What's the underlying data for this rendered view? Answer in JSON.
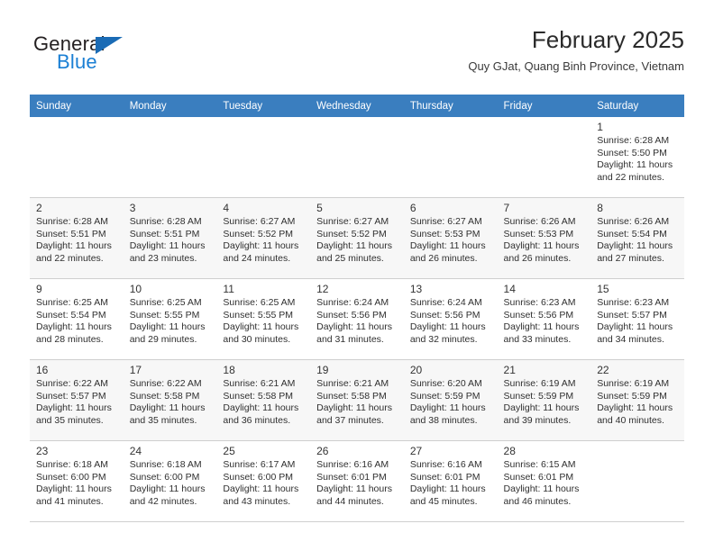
{
  "logo": {
    "text_top": "General",
    "text_bottom": "Blue",
    "triangle_icon": "blue-triangle-icon",
    "color_dark": "#231f20",
    "color_blue": "#1a7fd4"
  },
  "header": {
    "title": "February 2025",
    "subtitle": "Quy GJat, Quang Binh Province, Vietnam"
  },
  "theme": {
    "header_row_bg": "#3a7ebf",
    "header_row_text": "#ffffff",
    "row_alt_bg": "#f7f7f7",
    "row_bg": "#ffffff",
    "grid_line": "#cfcfcf"
  },
  "weekdays": [
    "Sunday",
    "Monday",
    "Tuesday",
    "Wednesday",
    "Thursday",
    "Friday",
    "Saturday"
  ],
  "weeks": [
    [
      {
        "day": ""
      },
      {
        "day": ""
      },
      {
        "day": ""
      },
      {
        "day": ""
      },
      {
        "day": ""
      },
      {
        "day": ""
      },
      {
        "day": "1",
        "sunrise": "Sunrise: 6:28 AM",
        "sunset": "Sunset: 5:50 PM",
        "daylight1": "Daylight: 11 hours",
        "daylight2": "and 22 minutes."
      }
    ],
    [
      {
        "day": "2",
        "sunrise": "Sunrise: 6:28 AM",
        "sunset": "Sunset: 5:51 PM",
        "daylight1": "Daylight: 11 hours",
        "daylight2": "and 22 minutes."
      },
      {
        "day": "3",
        "sunrise": "Sunrise: 6:28 AM",
        "sunset": "Sunset: 5:51 PM",
        "daylight1": "Daylight: 11 hours",
        "daylight2": "and 23 minutes."
      },
      {
        "day": "4",
        "sunrise": "Sunrise: 6:27 AM",
        "sunset": "Sunset: 5:52 PM",
        "daylight1": "Daylight: 11 hours",
        "daylight2": "and 24 minutes."
      },
      {
        "day": "5",
        "sunrise": "Sunrise: 6:27 AM",
        "sunset": "Sunset: 5:52 PM",
        "daylight1": "Daylight: 11 hours",
        "daylight2": "and 25 minutes."
      },
      {
        "day": "6",
        "sunrise": "Sunrise: 6:27 AM",
        "sunset": "Sunset: 5:53 PM",
        "daylight1": "Daylight: 11 hours",
        "daylight2": "and 26 minutes."
      },
      {
        "day": "7",
        "sunrise": "Sunrise: 6:26 AM",
        "sunset": "Sunset: 5:53 PM",
        "daylight1": "Daylight: 11 hours",
        "daylight2": "and 26 minutes."
      },
      {
        "day": "8",
        "sunrise": "Sunrise: 6:26 AM",
        "sunset": "Sunset: 5:54 PM",
        "daylight1": "Daylight: 11 hours",
        "daylight2": "and 27 minutes."
      }
    ],
    [
      {
        "day": "9",
        "sunrise": "Sunrise: 6:25 AM",
        "sunset": "Sunset: 5:54 PM",
        "daylight1": "Daylight: 11 hours",
        "daylight2": "and 28 minutes."
      },
      {
        "day": "10",
        "sunrise": "Sunrise: 6:25 AM",
        "sunset": "Sunset: 5:55 PM",
        "daylight1": "Daylight: 11 hours",
        "daylight2": "and 29 minutes."
      },
      {
        "day": "11",
        "sunrise": "Sunrise: 6:25 AM",
        "sunset": "Sunset: 5:55 PM",
        "daylight1": "Daylight: 11 hours",
        "daylight2": "and 30 minutes."
      },
      {
        "day": "12",
        "sunrise": "Sunrise: 6:24 AM",
        "sunset": "Sunset: 5:56 PM",
        "daylight1": "Daylight: 11 hours",
        "daylight2": "and 31 minutes."
      },
      {
        "day": "13",
        "sunrise": "Sunrise: 6:24 AM",
        "sunset": "Sunset: 5:56 PM",
        "daylight1": "Daylight: 11 hours",
        "daylight2": "and 32 minutes."
      },
      {
        "day": "14",
        "sunrise": "Sunrise: 6:23 AM",
        "sunset": "Sunset: 5:56 PM",
        "daylight1": "Daylight: 11 hours",
        "daylight2": "and 33 minutes."
      },
      {
        "day": "15",
        "sunrise": "Sunrise: 6:23 AM",
        "sunset": "Sunset: 5:57 PM",
        "daylight1": "Daylight: 11 hours",
        "daylight2": "and 34 minutes."
      }
    ],
    [
      {
        "day": "16",
        "sunrise": "Sunrise: 6:22 AM",
        "sunset": "Sunset: 5:57 PM",
        "daylight1": "Daylight: 11 hours",
        "daylight2": "and 35 minutes."
      },
      {
        "day": "17",
        "sunrise": "Sunrise: 6:22 AM",
        "sunset": "Sunset: 5:58 PM",
        "daylight1": "Daylight: 11 hours",
        "daylight2": "and 35 minutes."
      },
      {
        "day": "18",
        "sunrise": "Sunrise: 6:21 AM",
        "sunset": "Sunset: 5:58 PM",
        "daylight1": "Daylight: 11 hours",
        "daylight2": "and 36 minutes."
      },
      {
        "day": "19",
        "sunrise": "Sunrise: 6:21 AM",
        "sunset": "Sunset: 5:58 PM",
        "daylight1": "Daylight: 11 hours",
        "daylight2": "and 37 minutes."
      },
      {
        "day": "20",
        "sunrise": "Sunrise: 6:20 AM",
        "sunset": "Sunset: 5:59 PM",
        "daylight1": "Daylight: 11 hours",
        "daylight2": "and 38 minutes."
      },
      {
        "day": "21",
        "sunrise": "Sunrise: 6:19 AM",
        "sunset": "Sunset: 5:59 PM",
        "daylight1": "Daylight: 11 hours",
        "daylight2": "and 39 minutes."
      },
      {
        "day": "22",
        "sunrise": "Sunrise: 6:19 AM",
        "sunset": "Sunset: 5:59 PM",
        "daylight1": "Daylight: 11 hours",
        "daylight2": "and 40 minutes."
      }
    ],
    [
      {
        "day": "23",
        "sunrise": "Sunrise: 6:18 AM",
        "sunset": "Sunset: 6:00 PM",
        "daylight1": "Daylight: 11 hours",
        "daylight2": "and 41 minutes."
      },
      {
        "day": "24",
        "sunrise": "Sunrise: 6:18 AM",
        "sunset": "Sunset: 6:00 PM",
        "daylight1": "Daylight: 11 hours",
        "daylight2": "and 42 minutes."
      },
      {
        "day": "25",
        "sunrise": "Sunrise: 6:17 AM",
        "sunset": "Sunset: 6:00 PM",
        "daylight1": "Daylight: 11 hours",
        "daylight2": "and 43 minutes."
      },
      {
        "day": "26",
        "sunrise": "Sunrise: 6:16 AM",
        "sunset": "Sunset: 6:01 PM",
        "daylight1": "Daylight: 11 hours",
        "daylight2": "and 44 minutes."
      },
      {
        "day": "27",
        "sunrise": "Sunrise: 6:16 AM",
        "sunset": "Sunset: 6:01 PM",
        "daylight1": "Daylight: 11 hours",
        "daylight2": "and 45 minutes."
      },
      {
        "day": "28",
        "sunrise": "Sunrise: 6:15 AM",
        "sunset": "Sunset: 6:01 PM",
        "daylight1": "Daylight: 11 hours",
        "daylight2": "and 46 minutes."
      },
      {
        "day": ""
      }
    ]
  ]
}
